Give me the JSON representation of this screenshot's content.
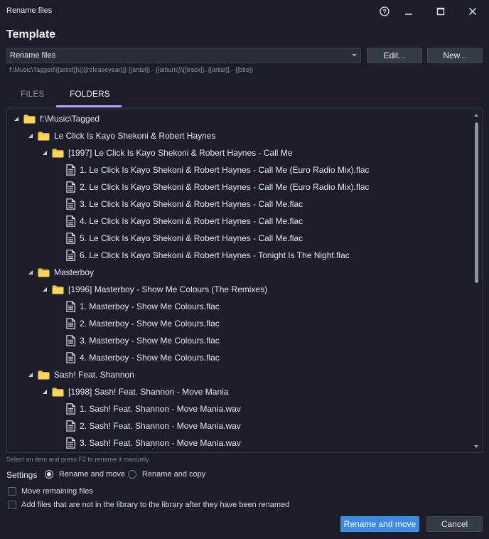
{
  "window": {
    "title": "Rename files",
    "help_glyph": "?",
    "minimize_glyph": "—",
    "maximize_glyph": "☐",
    "close_glyph": "✕"
  },
  "template": {
    "heading": "Template",
    "selected": "Rename files",
    "edit_label": "Edit...",
    "new_label": "New...",
    "pattern": "f:\\Music\\Tagged\\{[artist]}\\{[{[releaseyear}]} {[artist]} - {[album]}\\{[track]}. {[artist]} - {[title]}"
  },
  "tabs": {
    "files": "FILES",
    "folders": "FOLDERS",
    "active": "folders"
  },
  "tree": [
    {
      "type": "folder",
      "level": 0,
      "label": "f:\\Music\\Tagged"
    },
    {
      "type": "folder",
      "level": 1,
      "label": "Le Click Is Kayo Shekoni & Robert Haynes"
    },
    {
      "type": "folder",
      "level": 2,
      "label": "[1997] Le Click Is Kayo Shekoni & Robert Haynes - Call Me"
    },
    {
      "type": "file",
      "level": 3,
      "label": "1. Le Click Is Kayo Shekoni & Robert Haynes - Call Me (Euro Radio Mix).flac"
    },
    {
      "type": "file",
      "level": 3,
      "label": "2. Le Click Is Kayo Shekoni & Robert Haynes - Call Me (Euro Radio Mix).flac"
    },
    {
      "type": "file",
      "level": 3,
      "label": "3. Le Click Is Kayo Shekoni & Robert Haynes - Call Me.flac"
    },
    {
      "type": "file",
      "level": 3,
      "label": "4. Le Click Is Kayo Shekoni & Robert Haynes - Call Me.flac"
    },
    {
      "type": "file",
      "level": 3,
      "label": "5. Le Click Is Kayo Shekoni & Robert Haynes - Call Me.flac"
    },
    {
      "type": "file",
      "level": 3,
      "label": "6. Le Click Is Kayo Shekoni & Robert Haynes - Tonight Is The Night.flac"
    },
    {
      "type": "folder",
      "level": 1,
      "label": "Masterboy"
    },
    {
      "type": "folder",
      "level": 2,
      "label": "[1996] Masterboy - Show Me Colours (The Remixes)"
    },
    {
      "type": "file",
      "level": 3,
      "label": "1. Masterboy - Show Me Colours.flac"
    },
    {
      "type": "file",
      "level": 3,
      "label": "2. Masterboy - Show Me Colours.flac"
    },
    {
      "type": "file",
      "level": 3,
      "label": "3. Masterboy - Show Me Colours.flac"
    },
    {
      "type": "file",
      "level": 3,
      "label": "4. Masterboy - Show Me Colours.flac"
    },
    {
      "type": "folder",
      "level": 1,
      "label": "Sash! Feat. Shannon"
    },
    {
      "type": "folder",
      "level": 2,
      "label": "[1998] Sash! Feat. Shannon - Move Mania"
    },
    {
      "type": "file",
      "level": 3,
      "label": "1. Sash! Feat. Shannon - Move Mania.wav"
    },
    {
      "type": "file",
      "level": 3,
      "label": "2. Sash! Feat. Shannon - Move Mania.wav"
    },
    {
      "type": "file",
      "level": 3,
      "label": "3. Sash! Feat. Shannon - Move Mania.wav"
    }
  ],
  "hint": "Select an item and press F2 to rename it manually",
  "settings": {
    "label": "Settings",
    "options": [
      {
        "label": "Rename and move",
        "selected": true
      },
      {
        "label": "Rename and copy",
        "selected": false
      }
    ],
    "checkboxes": [
      {
        "label": "Move remaining files",
        "checked": false
      },
      {
        "label": "Add files that are not in the library to the library after they have been renamed",
        "checked": false
      }
    ]
  },
  "footer": {
    "primary_label": "Rename and move",
    "cancel_label": "Cancel"
  },
  "colors": {
    "background": "#1b1e29",
    "accent": "#3d8be6",
    "tab_underline": "#b79ef0",
    "folder": "#f6c142"
  }
}
